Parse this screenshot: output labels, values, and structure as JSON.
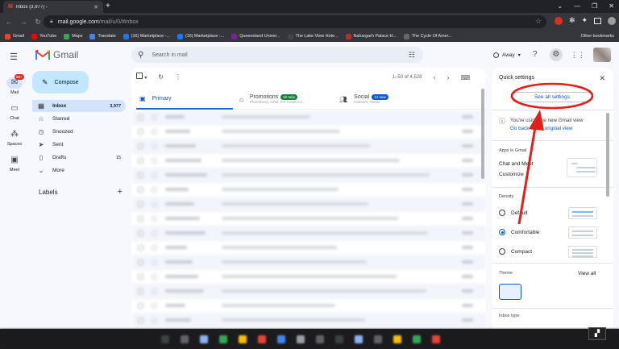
{
  "browser": {
    "tab_title": "Inbox (3,977) -",
    "url_host": "mail.google.com",
    "url_path": "/mail/u/0/#inbox",
    "bookmarks": [
      "Gmail",
      "YouTube",
      "Maps",
      "Translate",
      "(16) Marketplace -...",
      "(16) Marketplace -...",
      "Queensland Univer...",
      "The Lake View Hote...",
      "Nahargarh Palace H...",
      "The Cycle Of Amer..."
    ],
    "other_bookmarks": "Other bookmarks",
    "colors": {
      "bookmark_favicons": [
        "#ea4335",
        "#ff0000",
        "#34a853",
        "#4285f4",
        "#1877f2",
        "#1877f2",
        "#7b1fa2",
        "#444444",
        "#c62828",
        "#666666"
      ]
    }
  },
  "rail": {
    "items": [
      {
        "label": "Mail",
        "icon": "mail-icon",
        "badge": "99+"
      },
      {
        "label": "Chat",
        "icon": "chat-icon"
      },
      {
        "label": "Spaces",
        "icon": "spaces-icon"
      },
      {
        "label": "Meet",
        "icon": "meet-icon"
      }
    ]
  },
  "logo": "Gmail",
  "compose_label": "Compose",
  "nav": [
    {
      "label": "Inbox",
      "count": "3,977",
      "icon": "inbox-icon"
    },
    {
      "label": "Starred",
      "count": "",
      "icon": "star-icon"
    },
    {
      "label": "Snoozed",
      "count": "",
      "icon": "clock-icon"
    },
    {
      "label": "Sent",
      "count": "",
      "icon": "send-icon"
    },
    {
      "label": "Drafts",
      "count": "15",
      "icon": "draft-icon"
    },
    {
      "label": "More",
      "count": "",
      "icon": "chevron-down-icon"
    }
  ],
  "labels_heading": "Labels",
  "search_placeholder": "Search in mail",
  "status": "Away",
  "toolbar": {
    "pager": "1–50 of 4,528"
  },
  "tabs": [
    {
      "label": "Primary"
    },
    {
      "label": "Promotions",
      "pill": "50 new",
      "sub": "PharmEasy, Airtel, IFF Credit Ca...",
      "pill_color": "#188038"
    },
    {
      "label": "Social",
      "pill": "14 new",
      "sub": "LinkedIn, Twitter",
      "pill_color": "#0b57d0"
    }
  ],
  "quick_settings": {
    "title": "Quick settings",
    "see_all": "See all settings",
    "info_line1": "You're using the new Gmail view",
    "info_link": "Go back to the original view",
    "apps_heading": "Apps in Gmail",
    "chat_meet": "Chat and Meet",
    "customize": "Customize",
    "density_heading": "Density",
    "density_options": [
      {
        "label": "Default",
        "selected": false
      },
      {
        "label": "Comfortable",
        "selected": true
      },
      {
        "label": "Compact",
        "selected": false
      }
    ],
    "theme_heading": "Theme",
    "view_all": "View all",
    "inbox_type_heading": "Inbox type"
  }
}
